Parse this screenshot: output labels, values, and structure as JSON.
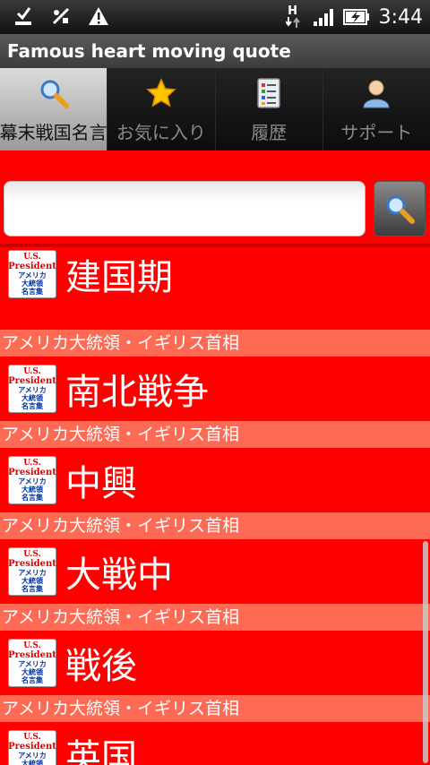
{
  "status_bar": {
    "time": "3:44",
    "icons": [
      "download-done-icon",
      "usb-debug-icon",
      "warning-icon",
      "hspa-data-icon",
      "signal-icon",
      "battery-charging-icon"
    ],
    "network_label": "H"
  },
  "app": {
    "title": "Famous heart moving quote"
  },
  "tabs": [
    {
      "label": "幕末戦国名言",
      "icon": "search-icon",
      "active": true
    },
    {
      "label": "お気に入り",
      "icon": "star-icon",
      "active": false
    },
    {
      "label": "履歴",
      "icon": "history-list-icon",
      "active": false
    },
    {
      "label": "サポート",
      "icon": "person-icon",
      "active": false
    }
  ],
  "search": {
    "value": "",
    "placeholder": ""
  },
  "badge": {
    "line1": "U.S.",
    "line2": "President",
    "line3": "アメリカ",
    "line4": "大統領",
    "line5": "名言集"
  },
  "list": [
    {
      "category": "",
      "title": "建国期"
    },
    {
      "category": "アメリカ大統領・イギリス首相",
      "title": "南北戦争"
    },
    {
      "category": "アメリカ大統領・イギリス首相",
      "title": "中興"
    },
    {
      "category": "アメリカ大統領・イギリス首相",
      "title": "大戦中"
    },
    {
      "category": "アメリカ大統領・イギリス首相",
      "title": "戦後"
    },
    {
      "category": "アメリカ大統領・イギリス首相",
      "title": "英国"
    }
  ],
  "colors": {
    "list_background": "#ff0000",
    "category_background": "#ff6a55",
    "active_tab": "#c8c8c8"
  }
}
